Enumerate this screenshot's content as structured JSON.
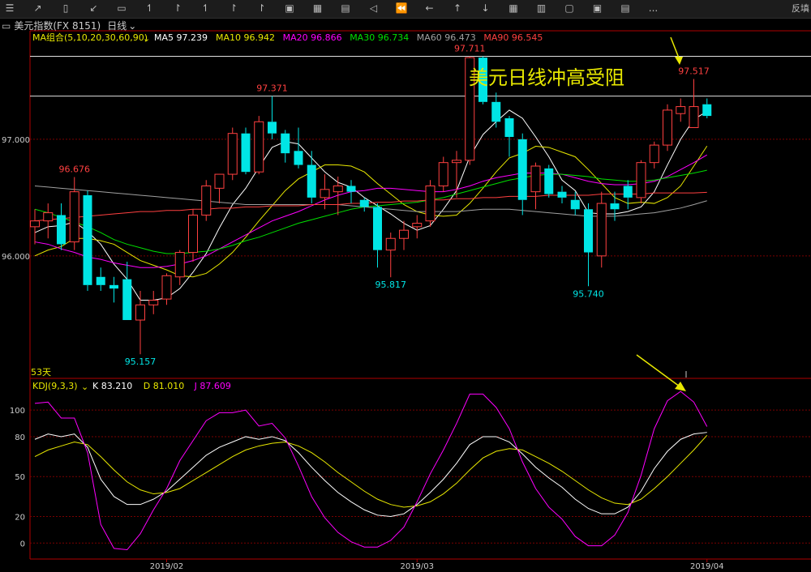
{
  "toolbar": {
    "icons": [
      "menu-icon",
      "chart-icon",
      "candle-icon",
      "draw-icon",
      "window-icon",
      "timeframe-1m-icon",
      "timeframe-5m-icon",
      "timeframe-15m-icon",
      "timeframe-30m-icon",
      "timeframe-60m-icon",
      "daily-icon",
      "weekly-icon",
      "monthly-icon",
      "prev-icon",
      "rewind-icon",
      "left-icon",
      "up-icon",
      "down-icon",
      "grid-icon",
      "layout-icon",
      "single-icon",
      "multi-icon",
      "cascade-icon",
      "more-icon"
    ],
    "more_label": "...",
    "right_label": "反填"
  },
  "header": {
    "symbol": "美元指数(FX 8151)",
    "period": "日线"
  },
  "ma_legend": [
    {
      "label": "MA组合(5,10,20,30,60,90)",
      "color": "#e8e800"
    },
    {
      "label": "MA5 97.239",
      "color": "#ffffff"
    },
    {
      "label": "MA10 96.942",
      "color": "#e8e800"
    },
    {
      "label": "MA20 96.866",
      "color": "#ff00ff"
    },
    {
      "label": "MA30 96.734",
      "color": "#00e000"
    },
    {
      "label": "MA60 96.473",
      "color": "#a0a0a0"
    },
    {
      "label": "MA90 96.545",
      "color": "#ff4040"
    }
  ],
  "kdj_legend": [
    {
      "label": "KDJ(9,3,3)",
      "color": "#e8e800"
    },
    {
      "label": "K 83.210",
      "color": "#ffffff"
    },
    {
      "label": "D 81.010",
      "color": "#e8e800"
    },
    {
      "label": "J 87.609",
      "color": "#ff00ff"
    }
  ],
  "annotation": {
    "text": "美元日线冲高受阻",
    "color": "#e8e800"
  },
  "days_label": "53天",
  "chart_data": [
    {
      "type": "candlestick",
      "title": "美元指数(FX 8151) 日线",
      "y_ticks": [
        96.0,
        97.0
      ],
      "y_tick_labels": [
        "96.000",
        "97.000"
      ],
      "ylim": [
        94.95,
        97.93
      ],
      "x_tick_labels": [
        "2019/02",
        "2019/03",
        "2019/04"
      ],
      "x_tick_index": [
        10,
        29,
        51
      ],
      "horizontal_lines": [
        97.711,
        97.37
      ],
      "price_labels": [
        {
          "text": "96.676",
          "index": 3,
          "value": 96.676,
          "color": "#ff4040"
        },
        {
          "text": "95.157",
          "index": 8,
          "value": 95.157,
          "color": "#00e5e5"
        },
        {
          "text": "97.371",
          "index": 18,
          "value": 97.371,
          "color": "#ff4040"
        },
        {
          "text": "95.817",
          "index": 27,
          "value": 95.817,
          "color": "#00e5e5"
        },
        {
          "text": "97.711",
          "index": 33,
          "value": 97.711,
          "color": "#ff4040"
        },
        {
          "text": "95.740",
          "index": 42,
          "value": 95.74,
          "color": "#00e5e5"
        },
        {
          "text": "97.517",
          "index": 50,
          "value": 97.517,
          "color": "#ff4040"
        }
      ],
      "candles": [
        {
          "o": 96.25,
          "h": 96.4,
          "l": 96.1,
          "c": 96.3
        },
        {
          "o": 96.3,
          "h": 96.45,
          "l": 96.15,
          "c": 96.37
        },
        {
          "o": 96.35,
          "h": 96.45,
          "l": 96.05,
          "c": 96.1
        },
        {
          "o": 96.12,
          "h": 96.676,
          "l": 96.05,
          "c": 96.55
        },
        {
          "o": 96.52,
          "h": 96.56,
          "l": 95.7,
          "c": 95.75
        },
        {
          "o": 95.82,
          "h": 95.9,
          "l": 95.7,
          "c": 95.75
        },
        {
          "o": 95.75,
          "h": 95.82,
          "l": 95.6,
          "c": 95.72
        },
        {
          "o": 95.8,
          "h": 95.95,
          "l": 95.45,
          "c": 95.45
        },
        {
          "o": 95.45,
          "h": 95.7,
          "l": 95.157,
          "c": 95.58
        },
        {
          "o": 95.58,
          "h": 95.7,
          "l": 95.5,
          "c": 95.62
        },
        {
          "o": 95.63,
          "h": 95.85,
          "l": 95.58,
          "c": 95.83
        },
        {
          "o": 95.82,
          "h": 96.05,
          "l": 95.75,
          "c": 96.03
        },
        {
          "o": 96.03,
          "h": 96.4,
          "l": 95.95,
          "c": 96.35
        },
        {
          "o": 96.35,
          "h": 96.65,
          "l": 96.3,
          "c": 96.6
        },
        {
          "o": 96.58,
          "h": 96.7,
          "l": 96.45,
          "c": 96.7
        },
        {
          "o": 96.7,
          "h": 97.1,
          "l": 96.65,
          "c": 97.05
        },
        {
          "o": 97.05,
          "h": 97.1,
          "l": 96.7,
          "c": 96.72
        },
        {
          "o": 96.72,
          "h": 97.2,
          "l": 96.7,
          "c": 97.15
        },
        {
          "o": 97.15,
          "h": 97.371,
          "l": 97.0,
          "c": 97.05
        },
        {
          "o": 97.05,
          "h": 97.08,
          "l": 96.8,
          "c": 96.88
        },
        {
          "o": 96.9,
          "h": 97.1,
          "l": 96.75,
          "c": 96.78
        },
        {
          "o": 96.78,
          "h": 96.9,
          "l": 96.45,
          "c": 96.5
        },
        {
          "o": 96.5,
          "h": 96.7,
          "l": 96.4,
          "c": 96.57
        },
        {
          "o": 96.55,
          "h": 96.68,
          "l": 96.35,
          "c": 96.6
        },
        {
          "o": 96.6,
          "h": 96.65,
          "l": 96.45,
          "c": 96.55
        },
        {
          "o": 96.48,
          "h": 96.5,
          "l": 96.38,
          "c": 96.42
        },
        {
          "o": 96.42,
          "h": 96.45,
          "l": 95.9,
          "c": 96.05
        },
        {
          "o": 96.05,
          "h": 96.2,
          "l": 95.817,
          "c": 96.15
        },
        {
          "o": 96.15,
          "h": 96.3,
          "l": 96.05,
          "c": 96.22
        },
        {
          "o": 96.25,
          "h": 96.35,
          "l": 96.15,
          "c": 96.28
        },
        {
          "o": 96.3,
          "h": 96.65,
          "l": 96.25,
          "c": 96.6
        },
        {
          "o": 96.6,
          "h": 96.85,
          "l": 96.55,
          "c": 96.8
        },
        {
          "o": 96.8,
          "h": 96.9,
          "l": 96.5,
          "c": 96.82
        },
        {
          "o": 96.82,
          "h": 97.711,
          "l": 96.78,
          "c": 97.7
        },
        {
          "o": 97.7,
          "h": 97.711,
          "l": 97.3,
          "c": 97.32
        },
        {
          "o": 97.32,
          "h": 97.4,
          "l": 97.1,
          "c": 97.15
        },
        {
          "o": 97.18,
          "h": 97.2,
          "l": 96.85,
          "c": 97.02
        },
        {
          "o": 97.0,
          "h": 97.05,
          "l": 96.35,
          "c": 96.48
        },
        {
          "o": 96.55,
          "h": 96.8,
          "l": 96.4,
          "c": 96.77
        },
        {
          "o": 96.75,
          "h": 96.78,
          "l": 96.5,
          "c": 96.53
        },
        {
          "o": 96.55,
          "h": 96.6,
          "l": 96.45,
          "c": 96.5
        },
        {
          "o": 96.48,
          "h": 96.55,
          "l": 96.35,
          "c": 96.4
        },
        {
          "o": 96.4,
          "h": 96.45,
          "l": 95.74,
          "c": 96.03
        },
        {
          "o": 96.0,
          "h": 96.55,
          "l": 95.9,
          "c": 96.45
        },
        {
          "o": 96.45,
          "h": 96.55,
          "l": 96.3,
          "c": 96.4
        },
        {
          "o": 96.6,
          "h": 96.65,
          "l": 96.4,
          "c": 96.5
        },
        {
          "o": 96.5,
          "h": 96.82,
          "l": 96.45,
          "c": 96.8
        },
        {
          "o": 96.8,
          "h": 96.98,
          "l": 96.75,
          "c": 96.95
        },
        {
          "o": 96.95,
          "h": 97.3,
          "l": 96.9,
          "c": 97.25
        },
        {
          "o": 97.22,
          "h": 97.35,
          "l": 97.15,
          "c": 97.28
        },
        {
          "o": 97.1,
          "h": 97.517,
          "l": 97.1,
          "c": 97.28
        },
        {
          "o": 97.3,
          "h": 97.35,
          "l": 97.18,
          "c": 97.2
        }
      ],
      "bull_color": "#ff4040",
      "bear_color": "#00e5e5",
      "series": [
        {
          "name": "MA5",
          "color": "#ffffff",
          "values": [
            96.2,
            96.25,
            96.26,
            96.29,
            96.21,
            96.1,
            95.93,
            95.8,
            95.62,
            95.62,
            95.64,
            95.72,
            95.86,
            96.02,
            96.24,
            96.44,
            96.58,
            96.76,
            96.93,
            96.98,
            96.96,
            96.84,
            96.72,
            96.63,
            96.59,
            96.5,
            96.43,
            96.36,
            96.28,
            96.22,
            96.26,
            96.4,
            96.56,
            96.85,
            97.04,
            97.15,
            97.25,
            97.18,
            97.02,
            96.85,
            96.65,
            96.56,
            96.37,
            96.36,
            96.36,
            96.38,
            96.42,
            96.55,
            96.78,
            97.0,
            97.17,
            97.239
          ]
        },
        {
          "name": "MA10",
          "color": "#e8e800",
          "values": [
            96.0,
            96.05,
            96.08,
            96.15,
            96.15,
            96.13,
            96.1,
            96.03,
            95.96,
            95.92,
            95.88,
            95.83,
            95.82,
            95.85,
            95.93,
            96.03,
            96.16,
            96.3,
            96.43,
            96.56,
            96.66,
            96.72,
            96.78,
            96.78,
            96.77,
            96.72,
            96.62,
            96.53,
            96.44,
            96.38,
            96.35,
            96.34,
            96.35,
            96.45,
            96.58,
            96.72,
            96.84,
            96.88,
            96.94,
            96.93,
            96.89,
            96.85,
            96.74,
            96.62,
            96.5,
            96.45,
            96.46,
            96.45,
            96.5,
            96.6,
            96.77,
            96.942
          ]
        },
        {
          "name": "MA20",
          "color": "#ff00ff",
          "values": [
            96.12,
            96.1,
            96.06,
            96.03,
            95.99,
            95.97,
            95.94,
            95.92,
            95.9,
            95.9,
            95.91,
            95.93,
            95.96,
            96.0,
            96.06,
            96.12,
            96.18,
            96.24,
            96.3,
            96.34,
            96.38,
            96.43,
            96.48,
            96.52,
            96.55,
            96.56,
            96.58,
            96.58,
            96.57,
            96.56,
            96.55,
            96.55,
            96.57,
            96.6,
            96.64,
            96.67,
            96.69,
            96.71,
            96.71,
            96.71,
            96.7,
            96.67,
            96.64,
            96.62,
            96.61,
            96.61,
            96.62,
            96.64,
            96.68,
            96.74,
            96.8,
            96.866
          ]
        },
        {
          "name": "MA30",
          "color": "#00e000",
          "values": [
            96.4,
            96.37,
            96.33,
            96.29,
            96.25,
            96.2,
            96.14,
            96.1,
            96.07,
            96.04,
            96.02,
            96.02,
            96.03,
            96.04,
            96.06,
            96.09,
            96.13,
            96.16,
            96.2,
            96.24,
            96.28,
            96.31,
            96.34,
            96.37,
            96.4,
            96.42,
            96.43,
            96.44,
            96.45,
            96.46,
            96.48,
            96.5,
            96.53,
            96.56,
            96.59,
            96.62,
            96.65,
            96.67,
            96.69,
            96.7,
            96.7,
            96.69,
            96.68,
            96.66,
            96.65,
            96.64,
            96.64,
            96.65,
            96.67,
            96.69,
            96.71,
            96.734
          ]
        },
        {
          "name": "MA60",
          "color": "#a0a0a0",
          "values": [
            96.6,
            96.59,
            96.58,
            96.57,
            96.56,
            96.55,
            96.54,
            96.53,
            96.52,
            96.51,
            96.5,
            96.49,
            96.48,
            96.47,
            96.46,
            96.45,
            96.44,
            96.44,
            96.44,
            96.44,
            96.44,
            96.44,
            96.44,
            96.44,
            96.43,
            96.42,
            96.41,
            96.4,
            96.39,
            96.38,
            96.38,
            96.38,
            96.38,
            96.39,
            96.4,
            96.4,
            96.4,
            96.39,
            96.38,
            96.37,
            96.36,
            96.35,
            96.34,
            96.34,
            96.34,
            96.35,
            96.36,
            96.37,
            96.39,
            96.41,
            96.44,
            96.473
          ]
        },
        {
          "name": "MA90",
          "color": "#ff4040",
          "values": [
            96.3,
            96.31,
            96.32,
            96.33,
            96.34,
            96.35,
            96.36,
            96.37,
            96.38,
            96.38,
            96.39,
            96.39,
            96.4,
            96.4,
            96.41,
            96.41,
            96.42,
            96.42,
            96.43,
            96.43,
            96.43,
            96.44,
            96.44,
            96.44,
            96.45,
            96.45,
            96.46,
            96.46,
            96.47,
            96.47,
            96.48,
            96.48,
            96.49,
            96.49,
            96.5,
            96.5,
            96.51,
            96.51,
            96.51,
            96.52,
            96.52,
            96.52,
            96.52,
            96.53,
            96.53,
            96.53,
            96.53,
            96.54,
            96.54,
            96.54,
            96.54,
            96.545
          ]
        }
      ]
    },
    {
      "type": "line",
      "title": "KDJ(9,3,3)",
      "y_ticks": [
        0,
        20,
        50,
        80,
        100
      ],
      "y_tick_labels": [
        "0",
        "20",
        "50",
        "80",
        "100"
      ],
      "ylim": [
        -12,
        122
      ],
      "series": [
        {
          "name": "K",
          "color": "#ffffff",
          "values": [
            78,
            82,
            80,
            82,
            72,
            48,
            35,
            29,
            29,
            33,
            39,
            48,
            57,
            66,
            72,
            76,
            80,
            78,
            80,
            77,
            68,
            57,
            47,
            38,
            31,
            25,
            21,
            20,
            22,
            29,
            38,
            48,
            60,
            74,
            80,
            80,
            76,
            67,
            57,
            49,
            42,
            33,
            26,
            22,
            22,
            27,
            39,
            56,
            69,
            78,
            82,
            83.21
          ]
        },
        {
          "name": "D",
          "color": "#e8e800",
          "values": [
            65,
            70,
            73,
            76,
            74,
            65,
            55,
            46,
            40,
            37,
            38,
            41,
            47,
            53,
            59,
            65,
            70,
            73,
            75,
            76,
            73,
            68,
            61,
            53,
            46,
            39,
            33,
            29,
            27,
            28,
            31,
            37,
            45,
            55,
            64,
            69,
            71,
            70,
            65,
            60,
            54,
            47,
            40,
            34,
            30,
            29,
            33,
            41,
            50,
            60,
            70,
            81.01
          ]
        },
        {
          "name": "J",
          "color": "#ff00ff",
          "values": [
            105,
            106,
            94,
            94,
            68,
            14,
            -4,
            -5,
            7,
            25,
            41,
            62,
            77,
            92,
            98,
            98,
            100,
            88,
            90,
            79,
            58,
            35,
            19,
            8,
            1,
            -3,
            -3,
            2,
            12,
            31,
            52,
            70,
            90,
            112,
            112,
            102,
            86,
            61,
            41,
            27,
            18,
            5,
            -2,
            -2,
            6,
            23,
            51,
            86,
            107,
            114,
            106,
            87.61
          ]
        }
      ]
    }
  ]
}
